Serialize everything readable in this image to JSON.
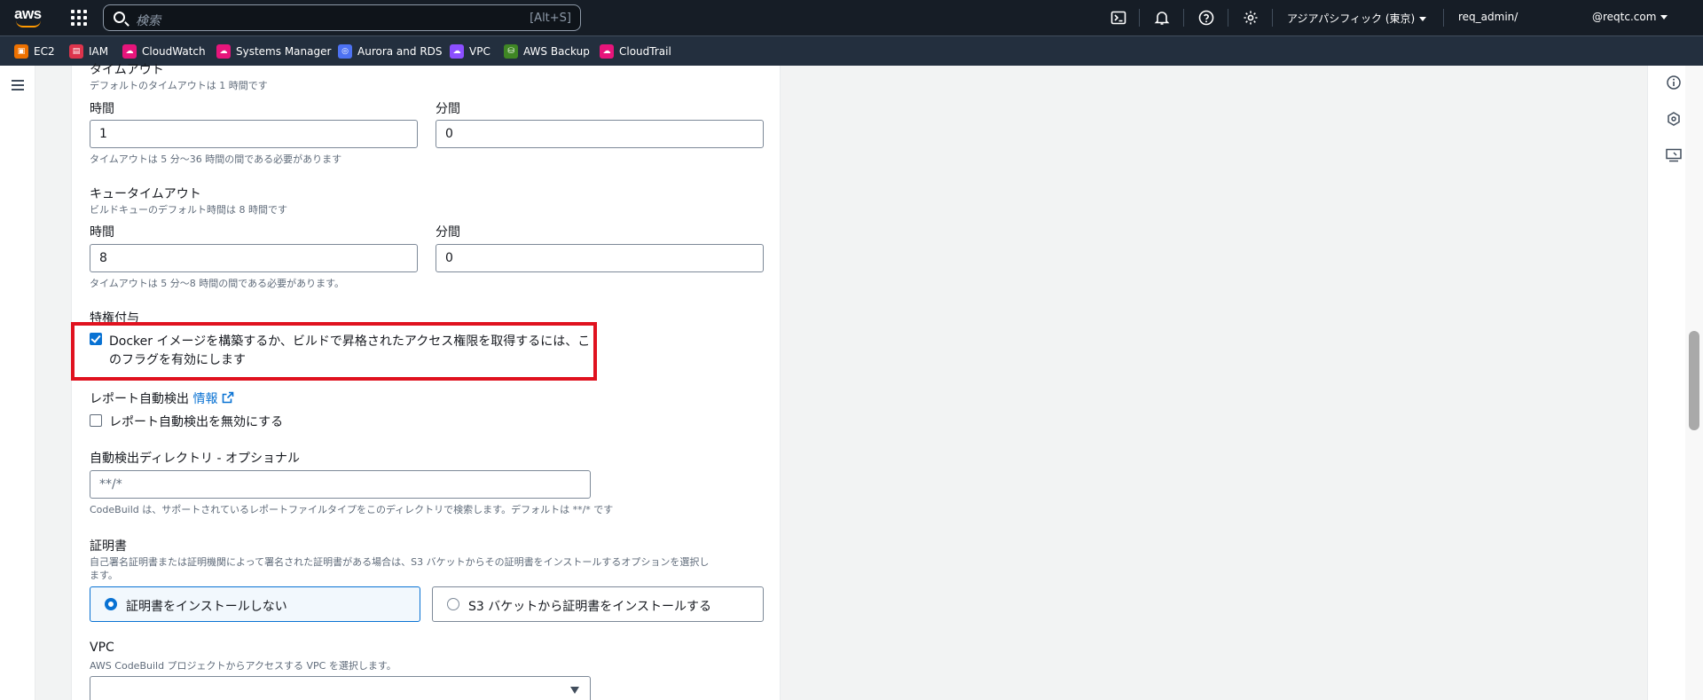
{
  "topbar": {
    "logo_text": "aws",
    "search_placeholder": "検索",
    "search_shortcut": "[Alt+S]",
    "region": "アジアパシフィック (東京)",
    "account": "req_admin/",
    "user": "@reqtc.com"
  },
  "favorites": [
    {
      "label": "EC2",
      "color": "#ed7100"
    },
    {
      "label": "IAM",
      "color": "#dd344c"
    },
    {
      "label": "CloudWatch",
      "color": "#e7157b"
    },
    {
      "label": "Systems Manager",
      "color": "#e7157b"
    },
    {
      "label": "Aurora and RDS",
      "color": "#4d72f3"
    },
    {
      "label": "VPC",
      "color": "#8c4fff"
    },
    {
      "label": "AWS Backup",
      "color": "#3f8624"
    },
    {
      "label": "CloudTrail",
      "color": "#e7157b"
    }
  ],
  "timeout": {
    "title": "タイムアウト",
    "desc": "デフォルトのタイムアウトは 1 時間です",
    "hours_label": "時間",
    "minutes_label": "分間",
    "hours_value": "1",
    "minutes_value": "0",
    "hint": "タイムアウトは 5 分〜36 時間の間である必要があります"
  },
  "queue_timeout": {
    "title": "キュータイムアウト",
    "desc": "ビルドキューのデフォルト時間は 8 時間です",
    "hours_label": "時間",
    "minutes_label": "分間",
    "hours_value": "8",
    "minutes_value": "0",
    "hint": "タイムアウトは 5 分〜8 時間の間である必要があります。"
  },
  "privileged": {
    "title": "特権付与",
    "checkbox_line1": "Docker イメージを構築するか、ビルドで昇格されたアクセス権限を取得するには、こ",
    "checkbox_line2": "のフラグを有効にします",
    "checked": true
  },
  "report": {
    "title": "レポート自動検出",
    "info_link": "情報",
    "checkbox_label": "レポート自動検出を無効にする",
    "checked": false
  },
  "autodetect_dir": {
    "title": "自動検出ディレクトリ - オプショナル",
    "placeholder": "**/*",
    "hint": "CodeBuild は、サポートされているレポートファイルタイプをこのディレクトリで検索します。デフォルトは **/* です"
  },
  "certificate": {
    "title": "証明書",
    "desc_line1": "自己署名証明書または証明機関によって署名された証明書がある場合は、S3 バケットからその証明書をインストールするオプションを選択し",
    "desc_line2": "ます。",
    "option_none": "証明書をインストールしない",
    "option_s3": "S3 バケットから証明書をインストールする",
    "selected": "none"
  },
  "vpc": {
    "title": "VPC",
    "desc": "AWS CodeBuild プロジェクトからアクセスする VPC を選択します。",
    "value": ""
  }
}
